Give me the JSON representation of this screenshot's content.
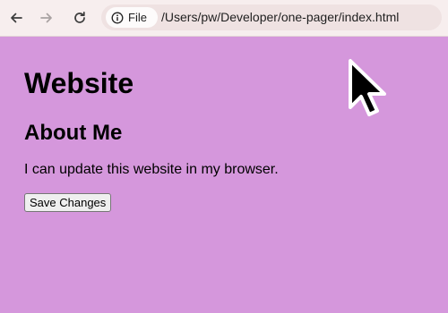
{
  "toolbar": {
    "back_icon": "arrow-left-icon",
    "forward_icon": "arrow-right-icon",
    "reload_icon": "reload-icon",
    "omnibox": {
      "chip_icon": "info-icon",
      "chip_label": "File",
      "url": "/Users/pw/Developer/one-pager/index.html"
    }
  },
  "page": {
    "background_color": "#d597dc",
    "title": "Website",
    "section_heading": "About Me",
    "body_text": "I can update this website in my browser.",
    "save_button_label": "Save Changes"
  },
  "cursor": {
    "icon": "mouse-pointer-icon"
  }
}
